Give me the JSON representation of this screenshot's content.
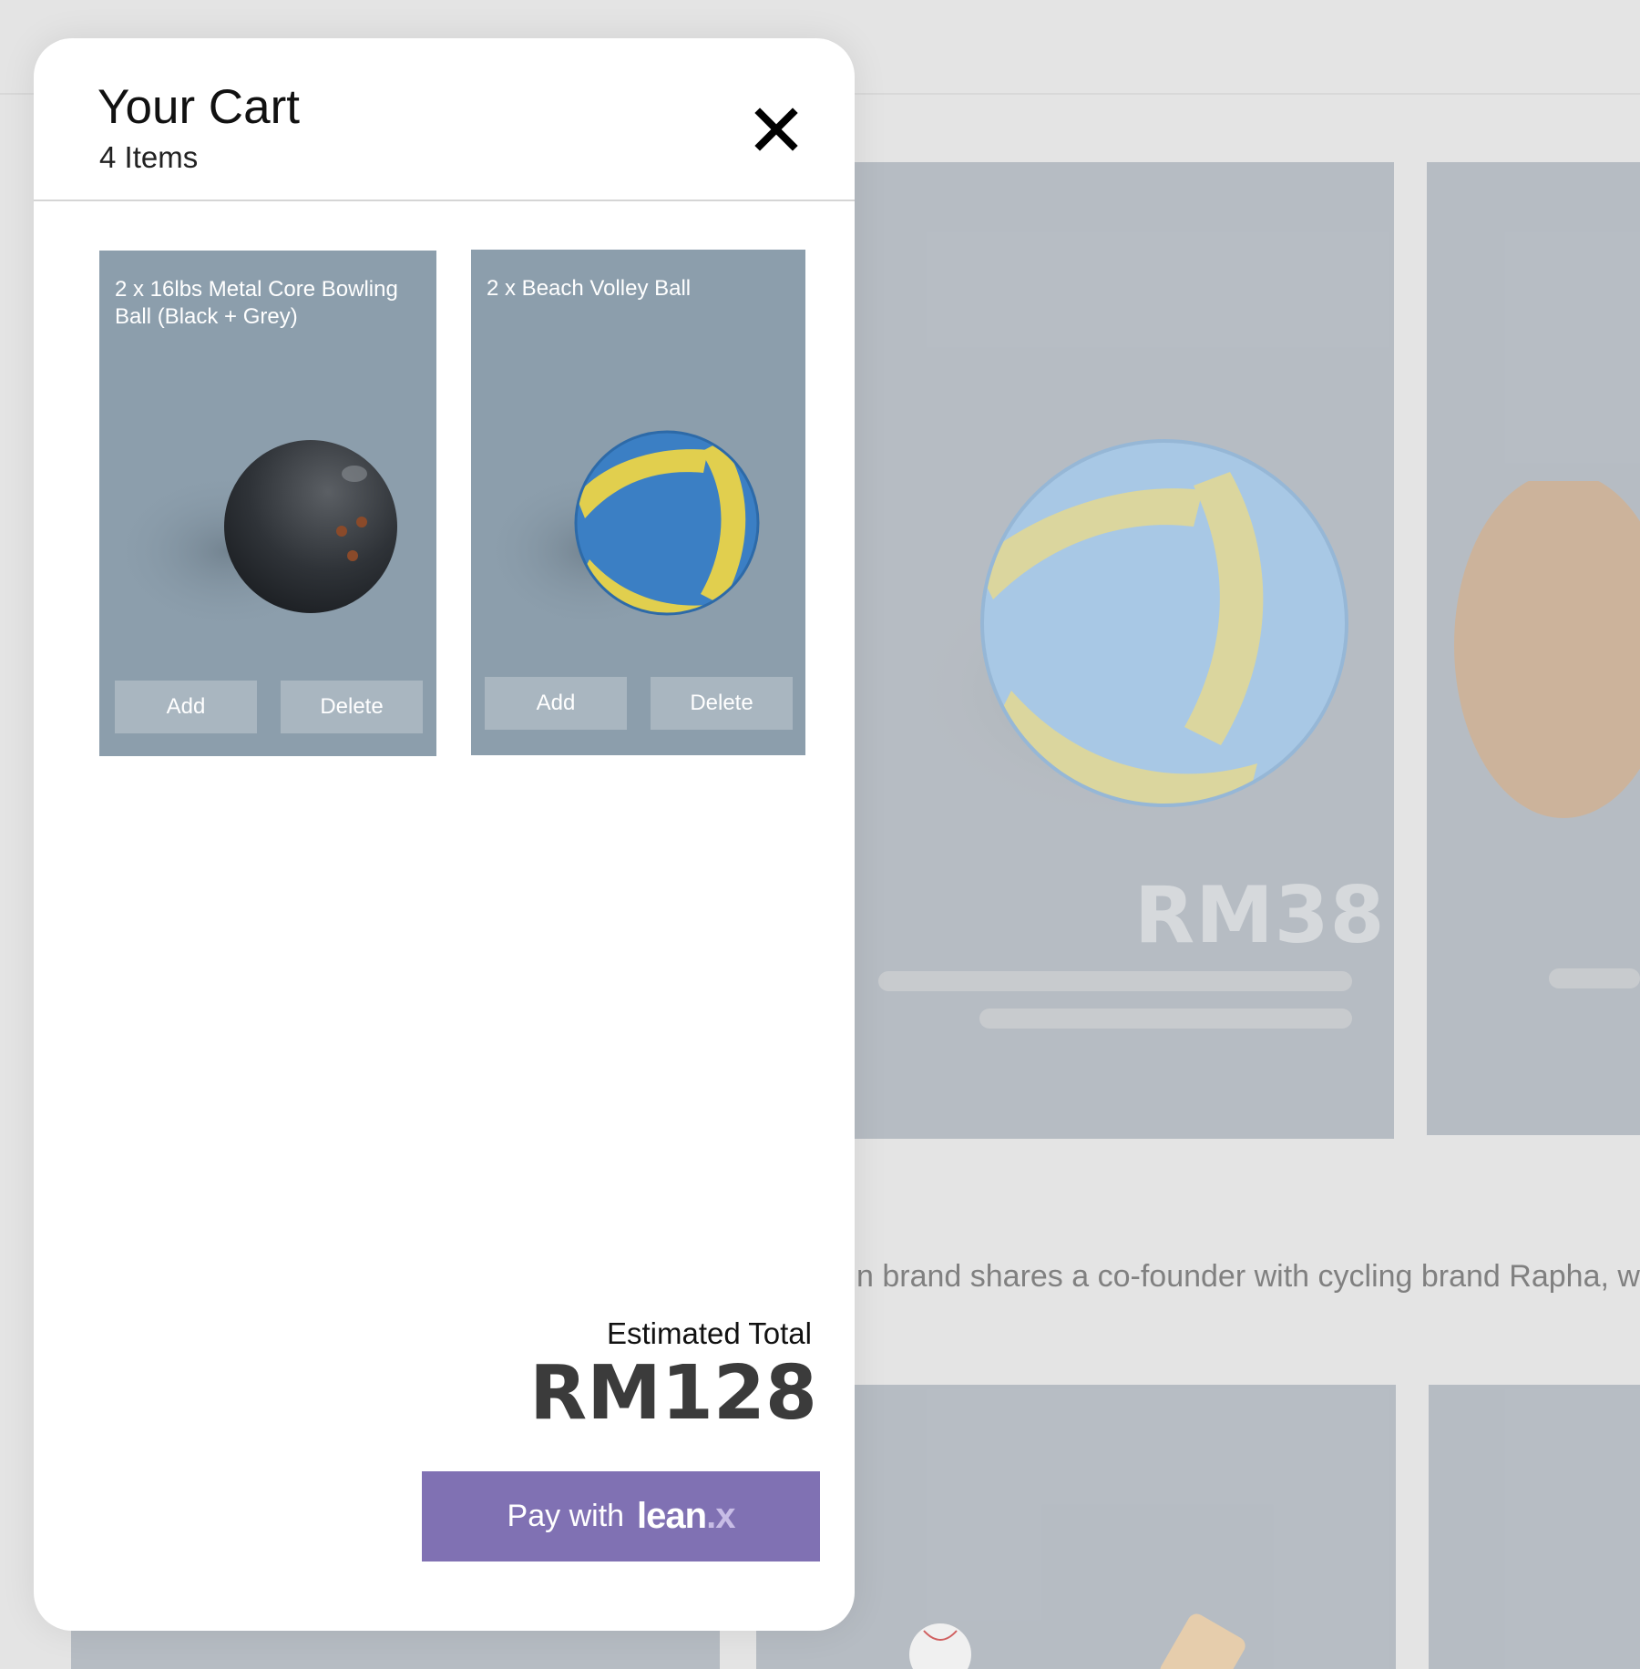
{
  "background": {
    "featured_price": "RM38",
    "description_text": "n brand shares a co-founder with cycling brand Rapha, w"
  },
  "cart": {
    "title": "Your Cart",
    "item_count_label": "4 Items",
    "close_icon": "close-icon",
    "items": [
      {
        "title": "2 x 16lbs Metal Core Bowling Ball (Black + Grey)",
        "image": "bowling-ball",
        "add_label": "Add",
        "delete_label": "Delete"
      },
      {
        "title": "2 x Beach Volley Ball",
        "image": "volley-ball",
        "add_label": "Add",
        "delete_label": "Delete"
      }
    ],
    "total_label": "Estimated Total",
    "total_value": "RM128",
    "pay_label": "Pay with",
    "pay_brand": "lean.x",
    "pay_brand_main": "lean",
    "pay_brand_dot": ".x"
  },
  "colors": {
    "accent": "#8071b3",
    "card_bg": "#8c9eac",
    "button_bg": "#a9b6c0",
    "background": "#e4e4e4"
  }
}
